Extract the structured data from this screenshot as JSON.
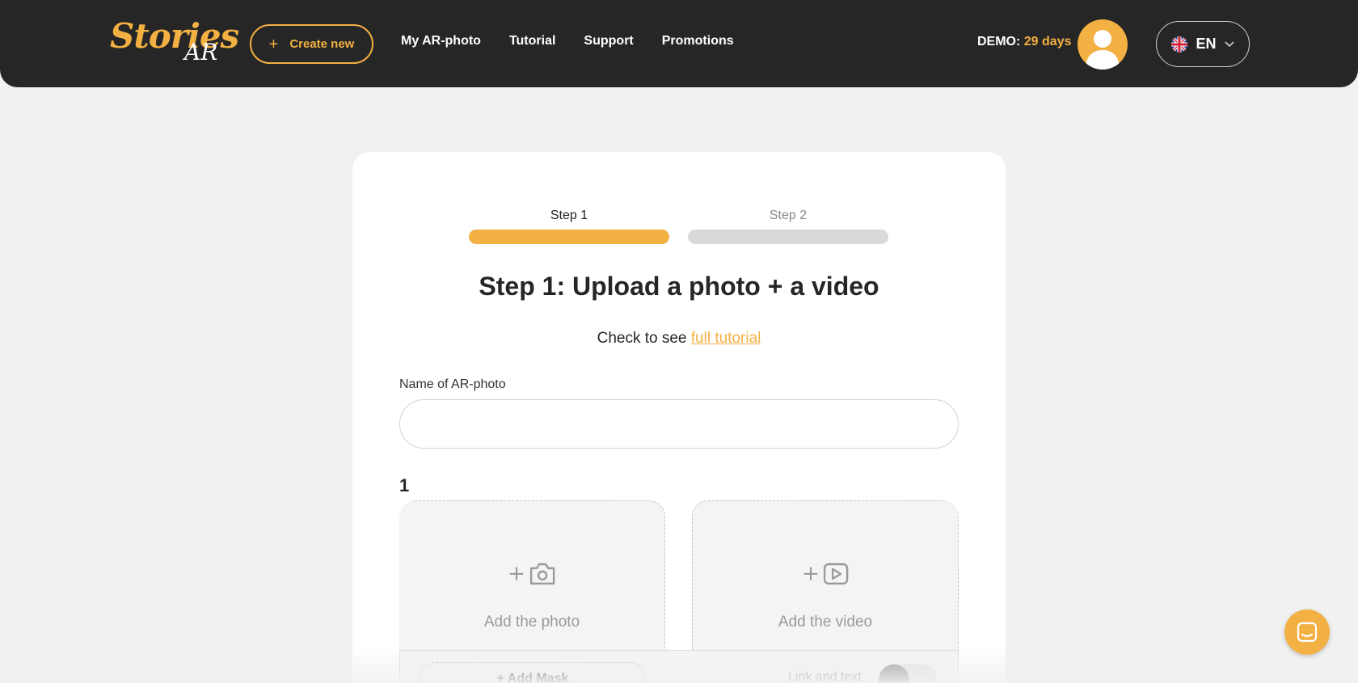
{
  "header": {
    "logo_main": "Stories",
    "logo_sub": "AR",
    "create_label": "Create new",
    "nav": [
      "My AR-photo",
      "Tutorial",
      "Support",
      "Promotions"
    ],
    "demo_label": "DEMO:",
    "demo_days": "29 days",
    "language": "EN"
  },
  "steps": {
    "step1": "Step 1",
    "step2": "Step 2",
    "progress_fraction": 0.5
  },
  "main": {
    "title": "Step 1: Upload a photo + a video",
    "tutorial_prefix": "Check to see",
    "tutorial_link": "full tutorial",
    "name_label": "Name of AR-photo",
    "name_value": "",
    "row_number": "1",
    "add_photo": "Add the photo",
    "add_video": "Add the video",
    "add_mask": "+ Add Mask",
    "link_and_text": "Link and text",
    "link_toggle_on": false
  },
  "colors": {
    "accent": "#f3b043",
    "header_bg": "#262626",
    "page_bg": "#f1f1f1"
  }
}
